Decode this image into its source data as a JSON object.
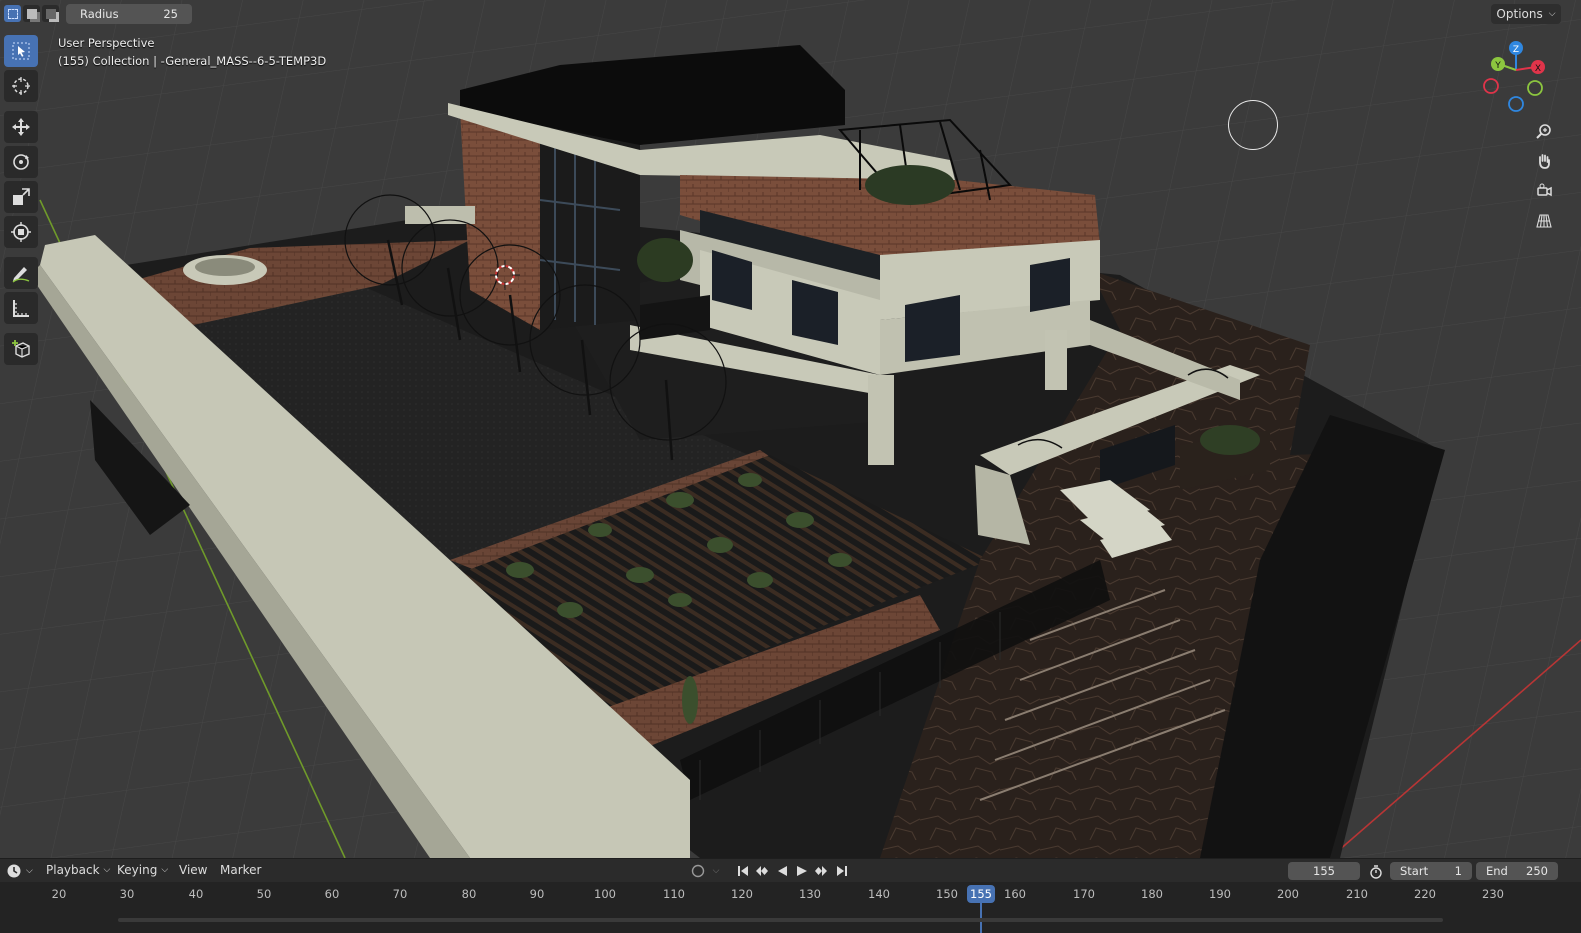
{
  "header": {
    "radius_label": "Radius",
    "radius_value": "25",
    "options_label": "Options"
  },
  "viewport": {
    "title": "User Perspective",
    "collection": "(155) Collection | -General_MASS--6-5-TEMP3D",
    "gizmo_axes": [
      "Z",
      "Y",
      "X"
    ]
  },
  "toolbar": {
    "tools": [
      "select-box",
      "cursor",
      "move",
      "rotate",
      "scale",
      "transform",
      "annotate",
      "measure",
      "add-cube"
    ]
  },
  "timeline": {
    "menus": [
      "Playback",
      "Keying",
      "View",
      "Marker"
    ],
    "current_frame": "155",
    "start_label": "Start",
    "start_value": "1",
    "end_label": "End",
    "end_value": "250",
    "ticks": [
      "20",
      "30",
      "40",
      "50",
      "60",
      "70",
      "80",
      "90",
      "100",
      "110",
      "120",
      "130",
      "140",
      "150",
      "160",
      "170",
      "180",
      "190",
      "200",
      "210",
      "220",
      "230"
    ],
    "cursor_frame": "155"
  },
  "colors": {
    "accent": "#4772b3",
    "x_axis": "#e0344a",
    "y_axis": "#8cc63f",
    "z_axis": "#2f87e0"
  }
}
